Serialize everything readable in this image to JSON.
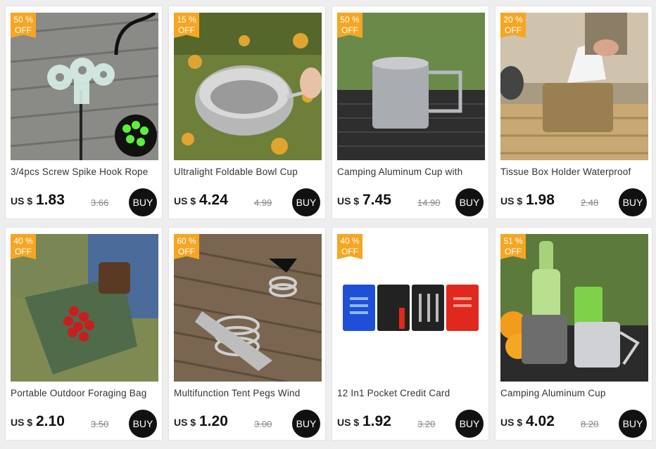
{
  "products": [
    {
      "discount": "50 %",
      "off": "OFF",
      "title": "3/4pcs Screw Spike Hook Rope",
      "currency": "US $",
      "price": "1.83",
      "old_price": "3.66",
      "buy": "BUY"
    },
    {
      "discount": "15 %",
      "off": "OFF",
      "title": "Ultralight Foldable Bowl Cup",
      "currency": "US $",
      "price": "4.24",
      "old_price": "4.99",
      "buy": "BUY"
    },
    {
      "discount": "50 %",
      "off": "OFF",
      "title": "Camping Aluminum Cup with",
      "currency": "US $",
      "price": "7.45",
      "old_price": "14.90",
      "buy": "BUY"
    },
    {
      "discount": "20 %",
      "off": "OFF",
      "title": "Tissue Box Holder Waterproof",
      "currency": "US $",
      "price": "1.98",
      "old_price": "2.48",
      "buy": "BUY"
    },
    {
      "discount": "40 %",
      "off": "OFF",
      "title": "Portable Outdoor Foraging Bag",
      "currency": "US $",
      "price": "2.10",
      "old_price": "3.50",
      "buy": "BUY"
    },
    {
      "discount": "60 %",
      "off": "OFF",
      "title": "Multifunction Tent Pegs Wind",
      "currency": "US $",
      "price": "1.20",
      "old_price": "3.00",
      "buy": "BUY"
    },
    {
      "discount": "40 %",
      "off": "OFF",
      "title": "12 In1 Pocket Credit Card",
      "currency": "US $",
      "price": "1.92",
      "old_price": "3.20",
      "buy": "BUY"
    },
    {
      "discount": "51 %",
      "off": "OFF",
      "title": "Camping Aluminum Cup",
      "currency": "US $",
      "price": "4.02",
      "old_price": "8.20",
      "buy": "BUY"
    }
  ],
  "colors": {
    "badge": "#f5a623",
    "buy_button": "#111111",
    "background": "#eeeeee"
  }
}
